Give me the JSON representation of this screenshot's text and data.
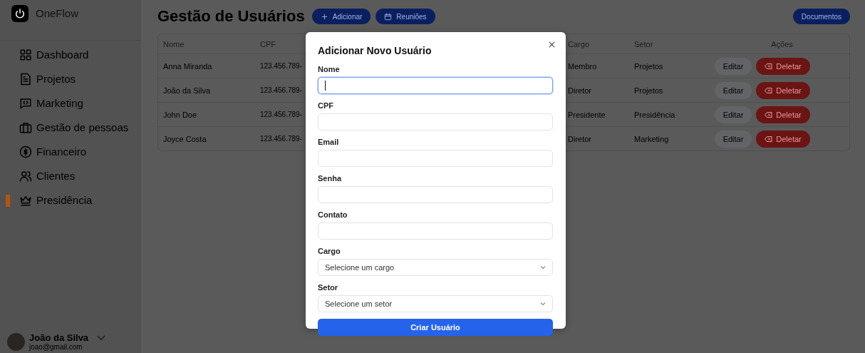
{
  "sidebar": {
    "brand": "OneFlow",
    "items": [
      {
        "label": "Dashboard",
        "selected": false
      },
      {
        "label": "Projetos",
        "selected": false
      },
      {
        "label": "Marketing",
        "selected": false
      },
      {
        "label": "Gestão de pessoas",
        "selected": false
      },
      {
        "label": "Financeiro",
        "selected": false
      },
      {
        "label": "Clientes",
        "selected": false
      },
      {
        "label": "Presidência",
        "selected": true
      }
    ],
    "user": {
      "name": "João da Silva",
      "email": "joao@gmail.com"
    }
  },
  "header": {
    "title": "Gestão de Usuários",
    "buttons": [
      {
        "label": "Adicionar"
      },
      {
        "label": "Reuniões"
      }
    ],
    "right_button": "Documentos"
  },
  "table": {
    "columns": [
      "Nome",
      "CPF",
      "Cargo",
      "Setor",
      "Ações"
    ],
    "rows": [
      {
        "nome": "Anna Miranda",
        "cpf": "123.456.789-",
        "cargo": "Membro",
        "setor": "Projetos",
        "edit": "Editar",
        "delete": "Deletar"
      },
      {
        "nome": "João da Silva",
        "cpf": "123.456.789-",
        "cargo": "Diretor",
        "setor": "Projetos",
        "edit": "Editar",
        "delete": "Deletar"
      },
      {
        "nome": "John Doe",
        "cpf": "123.456.789-",
        "cargo": "Presidente",
        "setor": "Presidência",
        "edit": "Editar",
        "delete": "Deletar"
      },
      {
        "nome": "Joyce Costa",
        "cpf": "123.456.789-",
        "cargo": "Diretor",
        "setor": "Marketing",
        "edit": "Editar",
        "delete": "Deletar"
      }
    ]
  },
  "modal": {
    "title": "Adicionar Novo Usuário",
    "fields": [
      {
        "kind": "input",
        "label": "Nome",
        "focused": true
      },
      {
        "kind": "input",
        "label": "CPF",
        "focused": false
      },
      {
        "kind": "input",
        "label": "Email",
        "focused": false
      },
      {
        "kind": "input",
        "label": "Senha",
        "focused": false
      },
      {
        "kind": "input",
        "label": "Contato",
        "focused": false
      },
      {
        "kind": "select",
        "label": "Cargo",
        "placeholder": "Selecione um cargo",
        "focused": false
      },
      {
        "kind": "select",
        "label": "Setor",
        "placeholder": "Selecione um setor",
        "focused": false
      }
    ],
    "submit": "Criar Usuário"
  }
}
